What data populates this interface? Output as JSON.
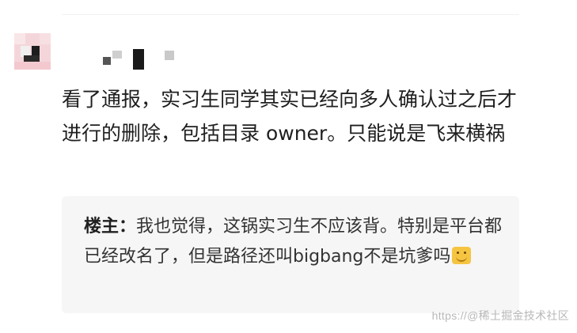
{
  "comment": {
    "body": "看了通报，实习生同学其实已经向多人确认过之后才进行的删除，包括目录 owner。只能说是飞来横祸"
  },
  "quoted_reply": {
    "author": "楼主：",
    "text": "我也觉得，这锅实习生不应该背。特别是平台都已经改名了，但是路径还叫bigbang不是坑爹吗",
    "emoji_icon": "grin-emoji-icon"
  },
  "watermark": {
    "text": "https://@稀土掘金技术社区"
  },
  "colors": {
    "quote_background": "#f6f6f6",
    "text_primary": "#1f1f1f",
    "watermark": "#b8b8b8"
  }
}
